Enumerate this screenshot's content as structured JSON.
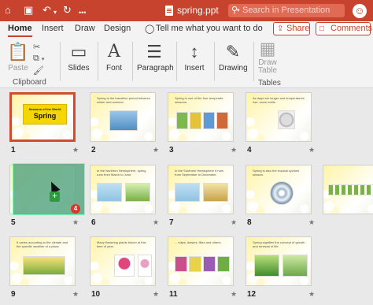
{
  "titlebar": {
    "file_name": "spring.ppt",
    "search_placeholder": "Search in Presentation",
    "icons": [
      "home-icon",
      "save-icon",
      "undo-icon",
      "redo-icon",
      "more-icon",
      "search-icon",
      "smiley-icon"
    ]
  },
  "tabs": {
    "items": [
      "Home",
      "Insert",
      "Draw",
      "Design"
    ],
    "active": "Home",
    "tell_me": "Tell me what you want to do",
    "share_label": "Share",
    "comments_label": "Comments"
  },
  "ribbon": {
    "paste_label": "Paste",
    "clipboard_label": "Clipboard",
    "slides_label": "Slides",
    "font_label": "Font",
    "paragraph_label": "Paragraph",
    "insert_label": "Insert",
    "drawing_label": "Drawing",
    "draw_table_label_1": "Draw",
    "draw_table_label_2": "Table",
    "tables_label": "Tables"
  },
  "slides": [
    {
      "number": "1",
      "title_small": "Seasons of the World",
      "title_big": "Spring",
      "selected": true
    },
    {
      "number": "2",
      "caption": "Spring is the transition period between winter and summer."
    },
    {
      "number": "3",
      "caption": "Spring is one of the four temperate seasons."
    },
    {
      "number": "4",
      "caption": "As days are longer and temperatures rise, snow melts."
    },
    {
      "number": "5",
      "caption": ""
    },
    {
      "number": "6",
      "caption": "In the Northern Hemisphere, spring runs from March to June."
    },
    {
      "number": "7",
      "caption": "In the Southern Hemisphere it runs from September to December."
    },
    {
      "number": "8",
      "caption": "Spring is also the tropical cyclone season."
    },
    {
      "number": "9",
      "caption": "It varies according to the climate and the specific weather of a place."
    },
    {
      "number": "10",
      "caption": "Many flowering plants bloom at this time of year."
    },
    {
      "number": "11",
      "caption": "... tulips, daisies, lilies and others."
    },
    {
      "number": "12",
      "caption": "Spring signifies the concept of growth and renewal of life."
    }
  ],
  "drag": {
    "count": "4",
    "plus": "+"
  },
  "colors": {
    "accent": "#c8432d",
    "slide_background": "#fff4a8",
    "selected_border": "#d24a32"
  }
}
